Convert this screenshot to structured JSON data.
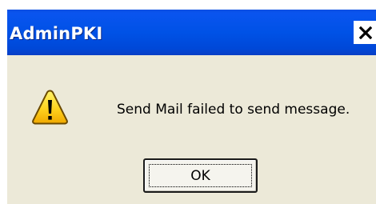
{
  "dialog": {
    "title": "AdminPKI",
    "message": "Send Mail failed to send message.",
    "ok_label": "OK",
    "icon": "warning-icon",
    "close_icon": "close-icon"
  },
  "colors": {
    "titlebar": "#0052e6",
    "dialog_background": "#ece9d8",
    "warning_yellow": "#ffd21e",
    "text": "#000000"
  }
}
